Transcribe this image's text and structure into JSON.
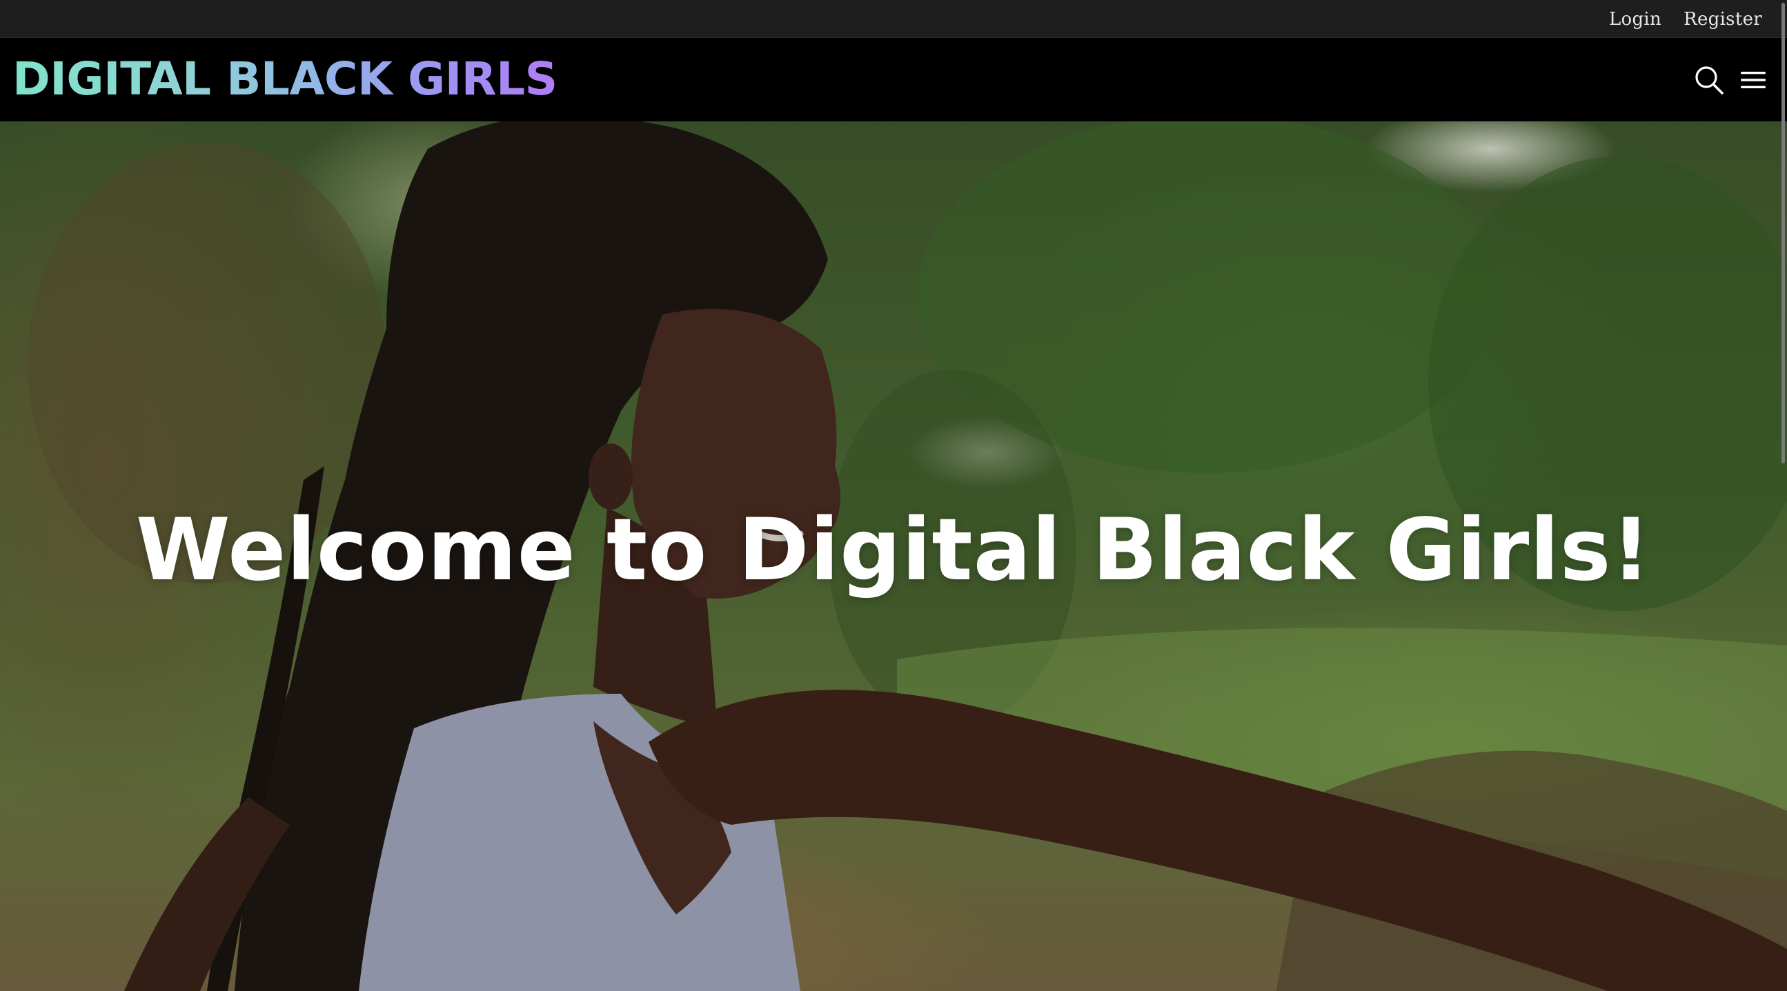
{
  "utility_nav": {
    "login_label": "Login",
    "register_label": "Register"
  },
  "header": {
    "logo_text": "DIGITAL BLACK GIRLS",
    "search_icon": "search-icon",
    "menu_icon": "hamburger-menu-icon"
  },
  "hero": {
    "title": "Welcome to Digital Black Girls!",
    "image": "hero-photo"
  },
  "colors": {
    "utility_bar_bg": "#1e1e1e",
    "header_bg": "#000000",
    "logo_gradient_start": "#7fe3c9",
    "logo_gradient_mid": "#92b8e6",
    "logo_gradient_end": "#b07cf4",
    "hero_title": "#ffffff"
  }
}
